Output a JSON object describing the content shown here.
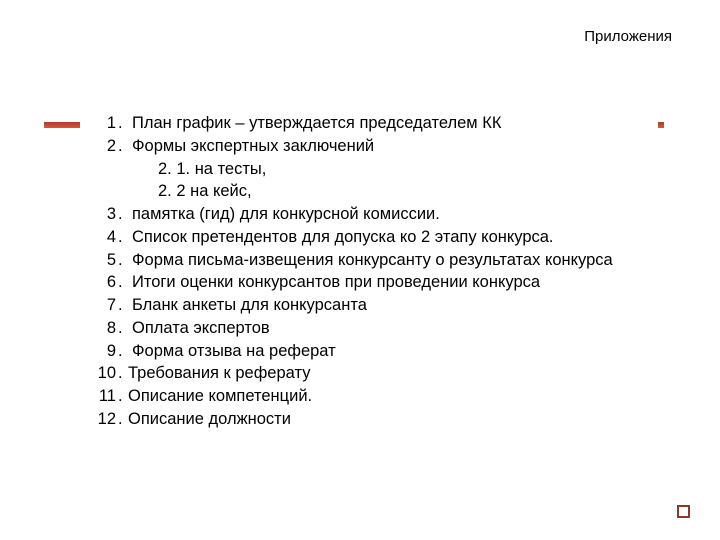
{
  "header": "Приложения",
  "items": [
    {
      "n": "1",
      "text": "План график – утверждается председателем КК"
    },
    {
      "n": "2",
      "text": "Формы экспертных заключений"
    },
    {
      "sub": true,
      "text": "2. 1. на тесты,"
    },
    {
      "sub": true,
      "text": "2. 2 на кейс,"
    },
    {
      "n": "3",
      "text": "памятка (гид) для конкурсной комиссии."
    },
    {
      "n": "4",
      "text": "Список претендентов для допуска ко 2 этапу конкурса."
    },
    {
      "n": "5",
      "text": " Форма письма-извещения конкурсанту о результатах конкурса"
    },
    {
      "n": "6",
      "text": "Итоги оценки конкурсантов при проведении конкурса"
    },
    {
      "n": "7",
      "text": "Бланк анкеты для конкурсанта"
    },
    {
      "n": "8",
      "text": "Оплата экспертов"
    },
    {
      "n": "9",
      "text": "Форма отзыва на реферат"
    },
    {
      "n": "10",
      "text": "Требования к реферату",
      "tight": true
    },
    {
      "n": "11",
      "text": "Описание компетенций.",
      "tight": true
    },
    {
      "n": "12",
      "text": "Описание должности",
      "tight": true
    }
  ]
}
